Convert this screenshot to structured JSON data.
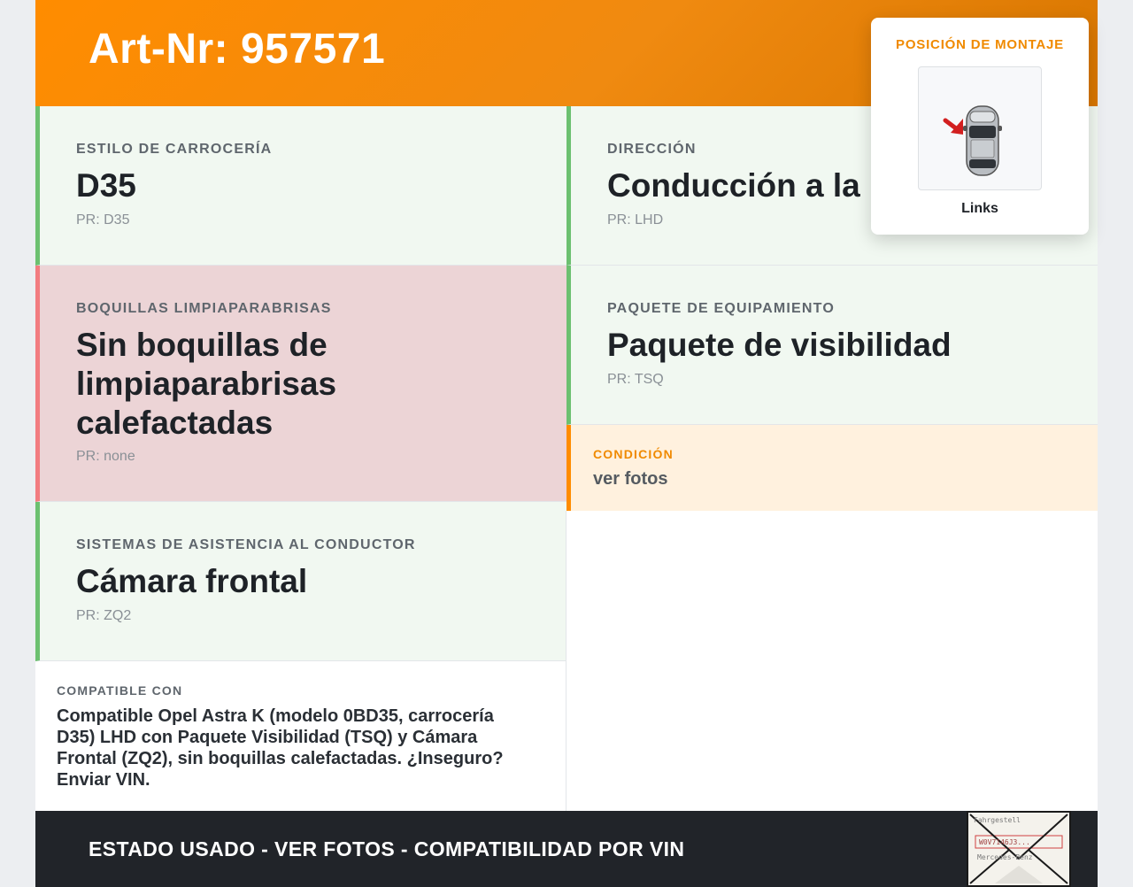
{
  "header": {
    "title": "Art-Nr: 957571"
  },
  "cards": {
    "body_style": {
      "label": "ESTILO DE CARROCERÍA",
      "value": "D35",
      "pr": "PR: D35"
    },
    "direction": {
      "label": "DIRECCIÓN",
      "value": "Conducción a la izquierda",
      "pr": "PR: LHD"
    },
    "nozzles": {
      "label": "BOQUILLAS LIMPIAPARABRISAS",
      "value": "Sin boquillas de limpiaparabrisas calefactadas",
      "pr": "PR: none"
    },
    "package": {
      "label": "PAQUETE DE EQUIPAMIENTO",
      "value": "Paquete de visibilidad",
      "pr": "PR: TSQ"
    },
    "assist": {
      "label": "SISTEMAS DE ASISTENCIA AL CONDUCTOR",
      "value": "Cámara frontal",
      "pr": "PR: ZQ2"
    }
  },
  "condition": {
    "label": "CONDICIÓN",
    "value": "ver fotos"
  },
  "compat": {
    "label": "COMPATIBLE CON",
    "text": "Compatible Opel Astra K (modelo 0BD35, carrocería D35) LHD con Paquete Visibilidad (TSQ) y Cámara Frontal (ZQ2), sin boquillas calefactadas. ¿Inseguro? Enviar VIN."
  },
  "footer": {
    "text": "ESTADO USADO - VER FOTOS - COMPATIBILIDAD POR VIN",
    "stamp_lines": [
      "Fahrgestell",
      "W0V7146J3...",
      "Mercedes-Benz"
    ]
  },
  "mount": {
    "title": "POSICIÓN DE MONTAJE",
    "caption": "Links"
  },
  "colors": {
    "accent": "#ff8c00",
    "ok_bg": "#f1f8f1",
    "ok_border": "#6cc070",
    "bad_bg": "#ecd4d6",
    "bad_border": "#f27c80",
    "footer_bg": "#212429"
  }
}
